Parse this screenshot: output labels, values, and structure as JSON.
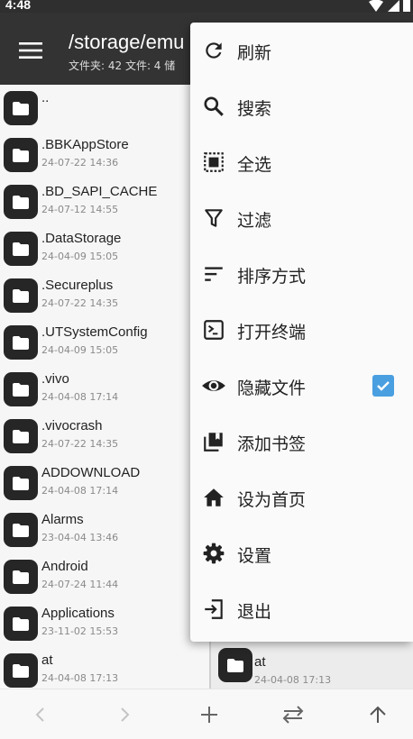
{
  "status_bar": {
    "time": "4:48"
  },
  "app_bar": {
    "title": "/storage/emu",
    "subtitle": "文件夹: 42  文件: 4  储"
  },
  "files": [
    {
      "name": "..",
      "date": ""
    },
    {
      "name": ".BBKAppStore",
      "date": "24-07-22 14:36"
    },
    {
      "name": ".BD_SAPI_CACHE",
      "date": "24-07-12 14:55"
    },
    {
      "name": ".DataStorage",
      "date": "24-04-09 15:05"
    },
    {
      "name": ".Secureplus",
      "date": "24-07-22 14:35"
    },
    {
      "name": ".UTSystemConfig",
      "date": "24-04-09 15:05"
    },
    {
      "name": ".vivo",
      "date": "24-04-08 17:14"
    },
    {
      "name": ".vivocrash",
      "date": "24-07-22 14:35"
    },
    {
      "name": "ADDOWNLOAD",
      "date": "24-04-08 17:14"
    },
    {
      "name": "Alarms",
      "date": "23-04-04 13:46"
    },
    {
      "name": "Android",
      "date": "24-07-24 11:44"
    },
    {
      "name": "Applications",
      "date": "23-11-02 15:53"
    },
    {
      "name": "at",
      "date": "24-04-08 17:13"
    }
  ],
  "second_pane": {
    "name": "at",
    "date": "24-04-08 17:13"
  },
  "menu": {
    "items": [
      {
        "label": "刷新",
        "icon": "refresh-icon"
      },
      {
        "label": "搜索",
        "icon": "search-icon"
      },
      {
        "label": "全选",
        "icon": "select-all-icon"
      },
      {
        "label": "过滤",
        "icon": "filter-icon"
      },
      {
        "label": "排序方式",
        "icon": "sort-icon"
      },
      {
        "label": "打开终端",
        "icon": "terminal-icon"
      },
      {
        "label": "隐藏文件",
        "icon": "eye-icon",
        "checked": true
      },
      {
        "label": "添加书签",
        "icon": "bookmark-icon"
      },
      {
        "label": "设为首页",
        "icon": "home-icon"
      },
      {
        "label": "设置",
        "icon": "settings-icon"
      },
      {
        "label": "退出",
        "icon": "exit-icon"
      }
    ]
  },
  "bottom_bar": [
    "back-icon",
    "forward-icon",
    "add-icon",
    "swap-icon",
    "up-icon"
  ],
  "colors": {
    "app_bar": "#333333",
    "folder_icon": "#262626",
    "checkbox": "#4a9fe0",
    "menu_bg": "#fafafa"
  }
}
